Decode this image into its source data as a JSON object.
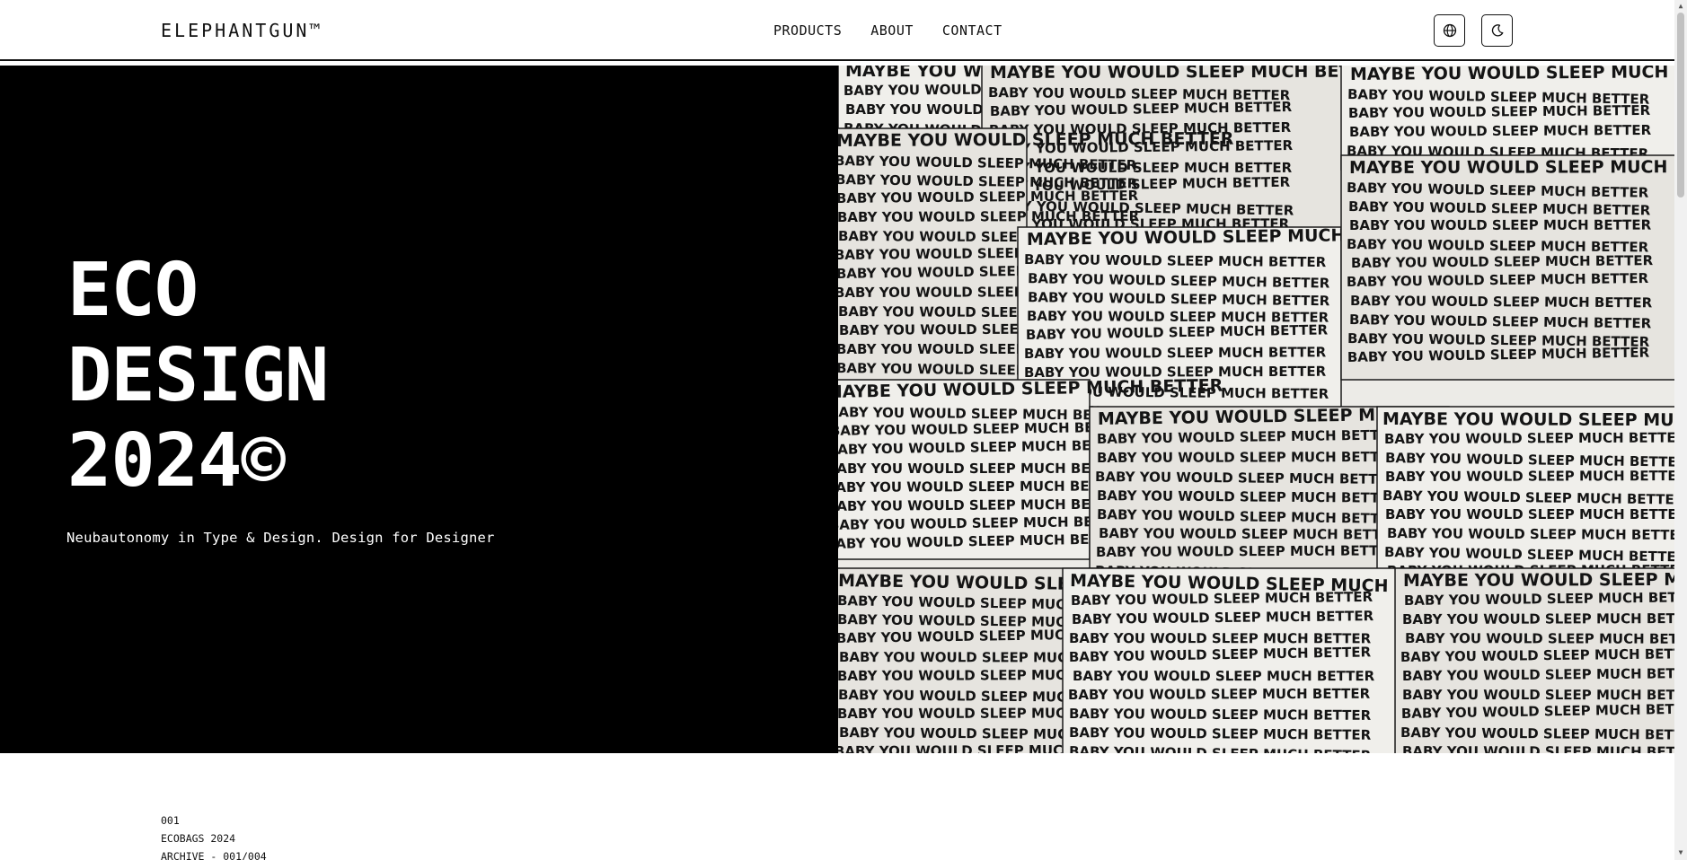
{
  "header": {
    "logo": "ELEPHANTGUN™",
    "nav": [
      "PRODUCTS",
      "ABOUT",
      "CONTACT"
    ],
    "icons": [
      "globe-icon",
      "moon-icon"
    ]
  },
  "hero": {
    "title_lines": [
      "ECO",
      "DESIGN",
      "2024©"
    ],
    "subtitle": "Neubautonomy in Type & Design. Design for Designer",
    "image_alt": "Collage of handwritten labels",
    "image_text": [
      "MAYBE YOU WOULD SLEEP MUCH BETTER",
      "BABY YOU WOULD SLEEP MUCH BETTER"
    ]
  },
  "archive": {
    "number": "001",
    "name": "ECOBAGS 2024",
    "label": "ARCHIVE - 001/004"
  },
  "colors": {
    "hero_bg": "#000000",
    "hero_text": "#ffffff",
    "paper": "#ecebe7",
    "ink": "#111111"
  }
}
